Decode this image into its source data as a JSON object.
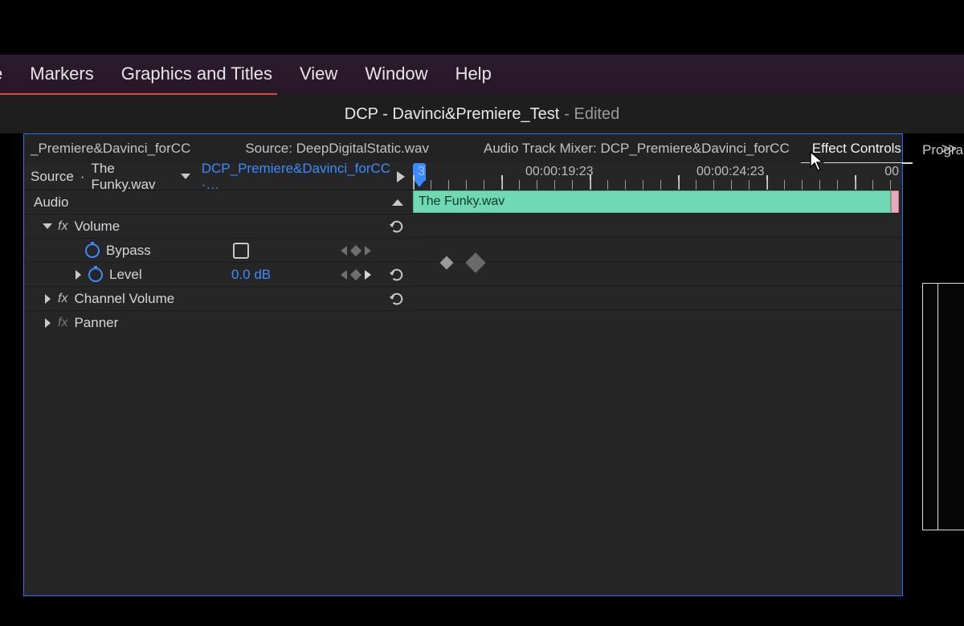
{
  "menu": {
    "items": [
      "ce",
      "Markers",
      "Graphics and Titles",
      "View",
      "Window",
      "Help"
    ]
  },
  "title": {
    "project": "DCP - Davinci&Premiere_Test",
    "suffix": "- Edited"
  },
  "tabs": {
    "t0": "_Premiere&Davinci_forCC",
    "t1": "Source: DeepDigitalStatic.wav",
    "t2": "Audio Track Mixer: DCP_Premiere&Davinci_forCC",
    "t3": "Effect Controls",
    "overflow": ">>",
    "program": "Program"
  },
  "source": {
    "label": "Source",
    "clip": "The Funky.wav",
    "seq": "DCP_Premiere&Davinci_forCC ·…"
  },
  "section": {
    "audio": "Audio"
  },
  "fx": {
    "volume": "Volume",
    "bypass": "Bypass",
    "level": "Level",
    "level_value": "0.0 dB",
    "channel_volume": "Channel Volume",
    "panner": "Panner"
  },
  "ruler": {
    "left_frag": "3",
    "tc1": "00:00:19:23",
    "tc2": "00:00:24:23",
    "right_frag": "00"
  },
  "clip": {
    "name": "The Funky.wav"
  }
}
